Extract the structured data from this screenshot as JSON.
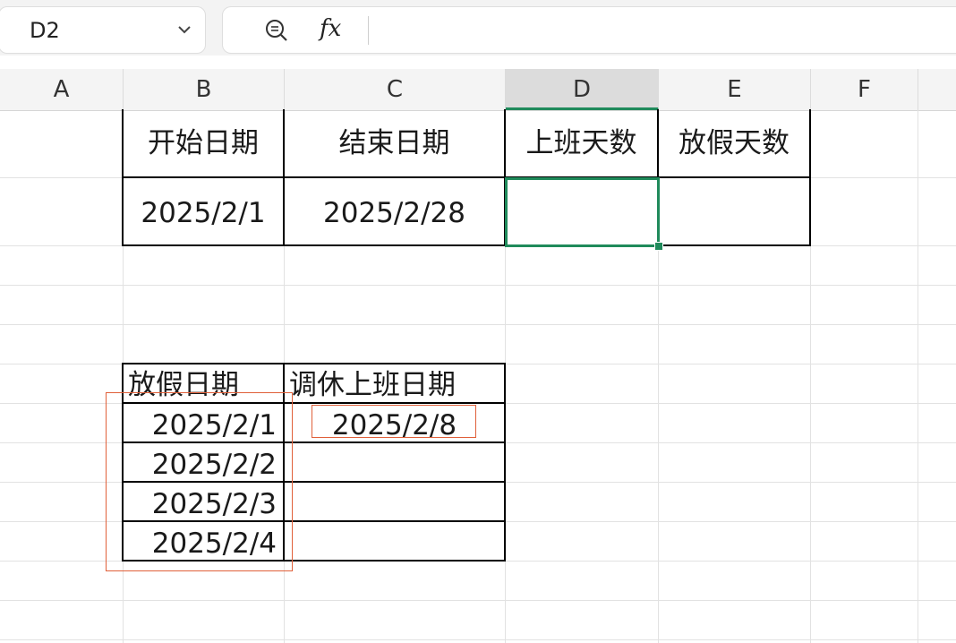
{
  "formula_bar": {
    "name_box": "D2",
    "fx_label": "fx",
    "formula": ""
  },
  "columns": [
    "A",
    "B",
    "C",
    "D",
    "E",
    "F"
  ],
  "selected_cell": "D2",
  "table1": {
    "headers": [
      "开始日期",
      "结束日期",
      "上班天数",
      "放假天数"
    ],
    "row": [
      "2025/2/1",
      "2025/2/28",
      "",
      ""
    ]
  },
  "table2": {
    "headers": [
      "放假日期",
      "调休上班日期"
    ],
    "holidays": [
      "2025/2/1",
      "2025/2/2",
      "2025/2/3",
      "2025/2/4"
    ],
    "workdays": [
      "2025/2/8",
      "",
      "",
      ""
    ]
  },
  "colors": {
    "selection": "#1f8a5b",
    "annotation": "#e0603a"
  }
}
